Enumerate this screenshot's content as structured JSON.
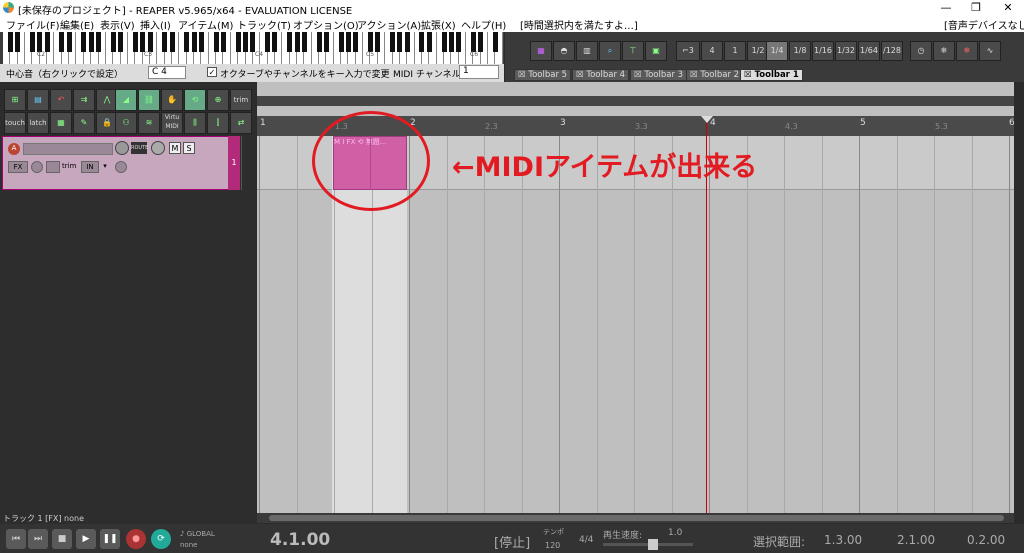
{
  "window": {
    "title": "[未保存のプロジェクト] - REAPER v5.965/x64 - EVALUATION LICENSE"
  },
  "menu": [
    "ファイル(F)",
    "編集(E)",
    "表示(V)",
    "挿入(I)",
    "アイテム(M)",
    "トラック(T)",
    "オプション(O)",
    "アクション(A)",
    "拡張(X)",
    "ヘルプ(H)",
    "[時間選択内を満たすよ…]"
  ],
  "audio_device": "[音声デバイスなし]",
  "midi_toolbar": {
    "center_label": "中心音（右クリックで設定）",
    "center_note": "C 4",
    "checkbox_label": "オクターブやチャンネルをキー入力で変更",
    "channel_label": "MIDI チャンネル:",
    "channel_value": "1"
  },
  "piano_octaves": [
    "C2",
    "C3",
    "C4",
    "C5",
    "C6"
  ],
  "grid_buttons": [
    "4",
    "1",
    "1/2",
    "1/4",
    "1/8",
    "1/16",
    "1/32",
    "1/64",
    "/128"
  ],
  "toolbar_tabs": [
    "Toolbar 5",
    "Toolbar 4",
    "Toolbar 3",
    "Toolbar 2",
    "Toolbar 1"
  ],
  "left_toolbar_labels": {
    "touch": "touch",
    "latch": "latch",
    "trim": "trim",
    "virtual_midi": "Virtu MIDI"
  },
  "track": {
    "number": "1",
    "mute": "M",
    "solo": "S",
    "fx": "FX",
    "trim": "trim",
    "in": "IN",
    "route": "ROUTE"
  },
  "item": {
    "header": "M I FX ⟲ 無題..."
  },
  "ruler": {
    "bars": [
      "1",
      "2",
      "3",
      "4",
      "5",
      "6"
    ],
    "subs": [
      "1.3",
      "2.3",
      "3.3",
      "4.3",
      "5.3"
    ]
  },
  "annotation": "←MIDIアイテムが出来る",
  "statusbar": {
    "track_info": "トラック 1 [FX] none"
  },
  "transport": {
    "position": "4.1.00",
    "state": "[停止]",
    "tempo_label": "テンポ",
    "tempo": "120",
    "time_sig": "4/4",
    "playrate_label": "再生速度:",
    "playrate": "1.0",
    "selection_label": "選択範囲:",
    "sel_start": "1.3.00",
    "sel_end": "2.1.00",
    "sel_len": "0.2.00",
    "global": "GLOBAL",
    "none": "none"
  }
}
